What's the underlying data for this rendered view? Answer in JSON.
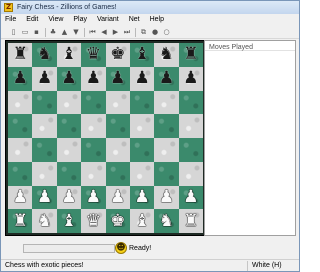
{
  "window": {
    "title": "Fairy Chess - Zillions of Games!",
    "app_icon_letter": "Z"
  },
  "menu": [
    "File",
    "Edit",
    "View",
    "Play",
    "Variant",
    "Net",
    "Help"
  ],
  "toolbar": [
    {
      "icon": "new-document-icon",
      "glyph": "▯"
    },
    {
      "icon": "open-folder-icon",
      "glyph": "▭"
    },
    {
      "icon": "save-icon",
      "glyph": "▪"
    },
    {
      "icon": "computer-move-icon",
      "glyph": "♣"
    },
    {
      "icon": "up-arrow-icon",
      "glyph": "▲"
    },
    {
      "icon": "down-arrow-icon",
      "glyph": "▼"
    },
    {
      "icon": "first-move-icon",
      "glyph": "⏮"
    },
    {
      "icon": "previous-move-icon",
      "glyph": "◀"
    },
    {
      "icon": "next-move-icon",
      "glyph": "▶"
    },
    {
      "icon": "last-move-icon",
      "glyph": "⏭"
    },
    {
      "icon": "board-options-icon",
      "glyph": "⧉"
    },
    {
      "icon": "stop-icon",
      "glyph": "●"
    },
    {
      "icon": "record-icon",
      "glyph": "○"
    }
  ],
  "board": {
    "rows": [
      [
        "♜",
        "♞",
        "♝",
        "♛",
        "♚",
        "♝",
        "♞",
        "♜"
      ],
      [
        "♟",
        "♟",
        "♟",
        "♟",
        "♟",
        "♟",
        "♟",
        "♟"
      ],
      [
        "",
        "",
        "",
        "",
        "",
        "",
        "",
        ""
      ],
      [
        "",
        "",
        "",
        "",
        "",
        "",
        "",
        ""
      ],
      [
        "",
        "",
        "",
        "",
        "",
        "",
        "",
        ""
      ],
      [
        "",
        "",
        "",
        "",
        "",
        "",
        "",
        ""
      ],
      [
        "♟",
        "♟",
        "♟",
        "♟",
        "♟",
        "♟",
        "♟",
        "♟"
      ],
      [
        "♜",
        "♞",
        "♝",
        "♛",
        "♚",
        "♝",
        "♞",
        "♜"
      ]
    ],
    "colors": [
      "black",
      "black",
      "",
      "",
      "",
      "",
      "white",
      "white"
    ],
    "dark_color": "#3b8a6c",
    "light_color": "#d6d6d6"
  },
  "moves_panel": {
    "header": "Moves Played"
  },
  "status": {
    "ready": "Ready!",
    "message": "Chess with exotic pieces!",
    "side": "White (H)"
  }
}
